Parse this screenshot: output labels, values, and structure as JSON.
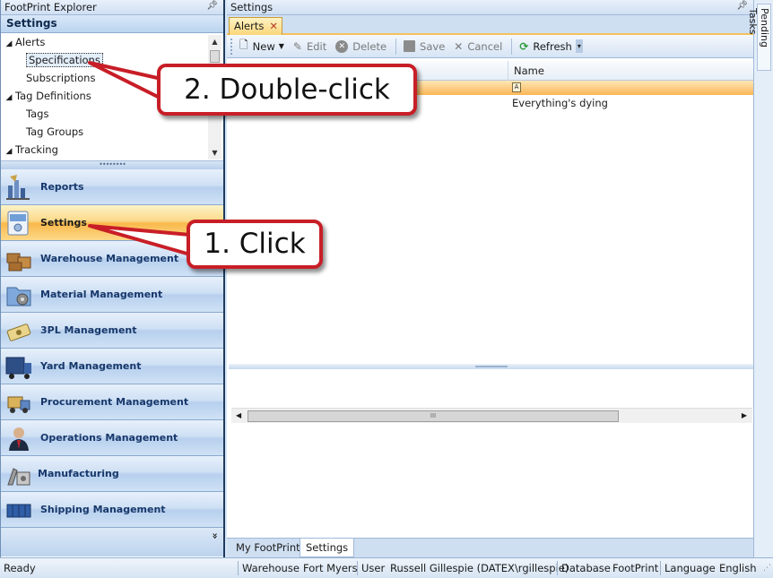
{
  "explorer": {
    "title": "FootPrint Explorer",
    "header": "Settings",
    "tree": [
      {
        "label": "Alerts",
        "level": 0,
        "toggle": "◢"
      },
      {
        "label": "Specifications",
        "level": 1,
        "selected": true
      },
      {
        "label": "Subscriptions",
        "level": 1
      },
      {
        "label": "Tag Definitions",
        "level": 0,
        "toggle": "◢"
      },
      {
        "label": "Tags",
        "level": 1
      },
      {
        "label": "Tag Groups",
        "level": 1
      },
      {
        "label": "Tracking",
        "level": 0,
        "toggle": "◢"
      }
    ],
    "nav": [
      {
        "label": "Reports",
        "icon": "reports-icon"
      },
      {
        "label": "Settings",
        "icon": "settings-icon",
        "active": true
      },
      {
        "label": "Warehouse Management",
        "icon": "warehouse-icon"
      },
      {
        "label": "Material Management",
        "icon": "material-icon"
      },
      {
        "label": "3PL Management",
        "icon": "3pl-icon"
      },
      {
        "label": "Yard Management",
        "icon": "yard-icon"
      },
      {
        "label": "Procurement Management",
        "icon": "procurement-icon"
      },
      {
        "label": "Operations Management",
        "icon": "operations-icon"
      },
      {
        "label": "Manufacturing",
        "icon": "manufacturing-icon"
      },
      {
        "label": "Shipping Management",
        "icon": "shipping-icon"
      }
    ],
    "more_glyph": "»"
  },
  "settings": {
    "title": "Settings",
    "tab_label": "Alerts",
    "toolbar": {
      "new": "New",
      "edit": "Edit",
      "delete": "Delete",
      "save": "Save",
      "cancel": "Cancel",
      "refresh": "Refresh"
    },
    "grid": {
      "column_name": "Name",
      "filter_glyph": "A",
      "rows": [
        "Everything's dying"
      ]
    },
    "scroll_grip": "III",
    "bottom_tabs": [
      "My FootPrint",
      "Settings"
    ]
  },
  "pending_tasks": "Pending Tasks",
  "status": {
    "ready": "Ready",
    "warehouse_label": "Warehouse",
    "warehouse_value": "Fort Myers",
    "user_label": "User",
    "user_value": "Russell Gillespie (DATEX\\rgillespie)",
    "database_label": "Database",
    "database_value": "FootPrint",
    "language_label": "Language",
    "language_value": "English"
  },
  "callouts": {
    "step1": "1. Click",
    "step2": "2. Double-click"
  },
  "colors": {
    "callout_border": "#c81e27",
    "active_nav": "#f9b94c",
    "panel_border": "#1f3a5c"
  }
}
